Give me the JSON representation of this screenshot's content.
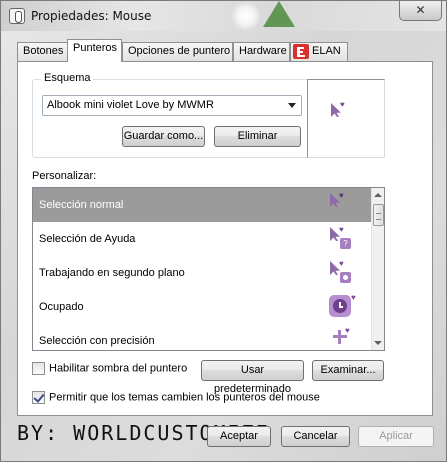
{
  "window": {
    "title": "Propiedades: Mouse",
    "close_glyph": "✕"
  },
  "tabs": [
    {
      "label": "Botones",
      "active": false
    },
    {
      "label": "Punteros",
      "active": true
    },
    {
      "label": "Opciones de puntero",
      "active": false
    },
    {
      "label": "Hardware",
      "active": false
    },
    {
      "label": "ELAN",
      "active": false,
      "icon": "elan-logo-icon"
    }
  ],
  "scheme": {
    "label": "Esquema",
    "selected": "Albook mini violet Love by MWMR",
    "save_label": "Guardar como...",
    "delete_label": "Eliminar"
  },
  "customize": {
    "label": "Personalizar:",
    "items": [
      {
        "label": "Selección normal",
        "selected": true,
        "icon": "arrow-cursor-icon"
      },
      {
        "label": "Selección de Ayuda",
        "selected": false,
        "icon": "help-cursor-icon"
      },
      {
        "label": "Trabajando en segundo plano",
        "selected": false,
        "icon": "working-cursor-icon"
      },
      {
        "label": "Ocupado",
        "selected": false,
        "icon": "busy-cursor-icon"
      },
      {
        "label": "Selección con precisión",
        "selected": false,
        "icon": "crosshair-cursor-icon"
      }
    ]
  },
  "options": {
    "shadow_label": "Habilitar sombra del puntero",
    "shadow_checked": false,
    "default_label": "Usar predeterminado",
    "browse_label": "Examinar...",
    "themes_label": "Permitir que los temas cambien los punteros del mouse",
    "themes_checked": true
  },
  "footer": {
    "watermark": "BY: WORLDCUSTOMIZE",
    "ok_label": "Aceptar",
    "cancel_label": "Cancelar",
    "apply_label": "Aplicar"
  },
  "colors": {
    "accent": "#8f6aa8",
    "selection": "#9b9b9b",
    "elan_red": "#d9322e"
  }
}
